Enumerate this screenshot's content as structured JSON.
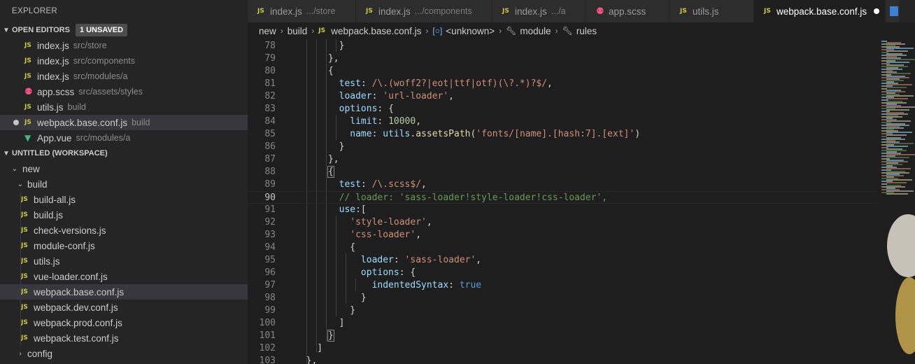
{
  "sidebar": {
    "title": "EXPLORER",
    "open_editors": {
      "label": "OPEN EDITORS",
      "badge": "1 UNSAVED",
      "items": [
        {
          "icon": "JS",
          "name": "index.js",
          "desc": "src/store"
        },
        {
          "icon": "JS",
          "name": "index.js",
          "desc": "src/components"
        },
        {
          "icon": "JS",
          "name": "index.js",
          "desc": "src/modules/a"
        },
        {
          "icon": "scss",
          "name": "app.scss",
          "desc": "src/assets/styles"
        },
        {
          "icon": "JS",
          "name": "utils.js",
          "desc": "build"
        },
        {
          "icon": "JS",
          "name": "webpack.base.conf.js",
          "desc": "build"
        },
        {
          "icon": "vue",
          "name": "App.vue",
          "desc": "src/modules/a"
        }
      ]
    },
    "workspace": {
      "label": "UNTITLED (WORKSPACE)",
      "root_folder": "new",
      "sub_folder": "build",
      "files": [
        "build-all.js",
        "build.js",
        "check-versions.js",
        "module-conf.js",
        "utils.js",
        "vue-loader.conf.js",
        "webpack.base.conf.js",
        "webpack.dev.conf.js",
        "webpack.prod.conf.js",
        "webpack.test.conf.js"
      ],
      "collapsed_folder": "config"
    }
  },
  "tabs": [
    {
      "icon": "JS",
      "name": "index.js",
      "desc": ".../store"
    },
    {
      "icon": "JS",
      "name": "index.js",
      "desc": ".../components"
    },
    {
      "icon": "JS",
      "name": "index.js",
      "desc": ".../a"
    },
    {
      "icon": "scss",
      "name": "app.scss",
      "desc": ""
    },
    {
      "icon": "JS",
      "name": "utils.js",
      "desc": ""
    },
    {
      "icon": "JS",
      "name": "webpack.base.conf.js",
      "desc": ""
    }
  ],
  "breadcrumbs": {
    "items": [
      "new",
      "build",
      "webpack.base.conf.js",
      "<unknown>",
      "module",
      "rules"
    ]
  },
  "editor": {
    "lines": [
      {
        "n": "78",
        "text": "        }"
      },
      {
        "n": "79",
        "text": "      },"
      },
      {
        "n": "80",
        "text": "      {"
      },
      {
        "n": "81",
        "text": "        test: /\\.(woff2?|eot|ttf|otf)(\\?.*)?$/,"
      },
      {
        "n": "82",
        "text": "        loader: 'url-loader',"
      },
      {
        "n": "83",
        "text": "        options: {"
      },
      {
        "n": "84",
        "text": "          limit: 10000,"
      },
      {
        "n": "85",
        "text": "          name: utils.assetsPath('fonts/[name].[hash:7].[ext]')"
      },
      {
        "n": "86",
        "text": "        }"
      },
      {
        "n": "87",
        "text": "      },"
      },
      {
        "n": "88",
        "text": "      {"
      },
      {
        "n": "89",
        "text": "        test: /\\.scss$/,"
      },
      {
        "n": "90",
        "text": "        // loader: 'sass-loader!style-loader!css-loader',"
      },
      {
        "n": "91",
        "text": "        use:["
      },
      {
        "n": "92",
        "text": "          'style-loader',"
      },
      {
        "n": "93",
        "text": "          'css-loader',"
      },
      {
        "n": "94",
        "text": "          {"
      },
      {
        "n": "95",
        "text": "            loader: 'sass-loader',"
      },
      {
        "n": "96",
        "text": "            options: {"
      },
      {
        "n": "97",
        "text": "              indentedSyntax: true"
      },
      {
        "n": "98",
        "text": "            }"
      },
      {
        "n": "99",
        "text": "          }"
      },
      {
        "n": "100",
        "text": "        ]"
      },
      {
        "n": "101",
        "text": "      }"
      },
      {
        "n": "102",
        "text": "    ]"
      },
      {
        "n": "103",
        "text": "  },"
      }
    ]
  },
  "colors": {
    "sidebar_bg": "#252526",
    "editor_bg": "#1e1e1e",
    "selection": "#37373d",
    "js_icon": "#cbcb41",
    "scss_icon": "#f55385",
    "vue_icon": "#41b883",
    "string": "#ce9178",
    "property": "#9cdcfe",
    "keyword": "#569cd6",
    "number": "#b5cea8",
    "comment": "#6a9955"
  }
}
